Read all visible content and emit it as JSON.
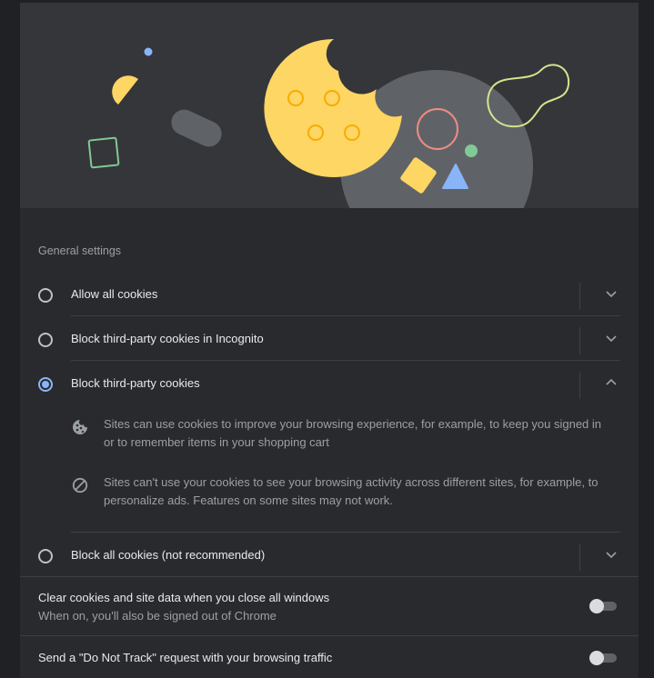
{
  "banner": {
    "illustration": "cookie-illustration"
  },
  "general": {
    "title": "General settings",
    "options": [
      {
        "label": "Allow all cookies",
        "selected": false,
        "expanded": false
      },
      {
        "label": "Block third-party cookies in Incognito",
        "selected": false,
        "expanded": false
      },
      {
        "label": "Block third-party cookies",
        "selected": true,
        "expanded": true
      },
      {
        "label": "Block all cookies (not recommended)",
        "selected": false,
        "expanded": false
      }
    ],
    "details": [
      {
        "icon": "cookie-icon",
        "text": "Sites can use cookies to improve your browsing experience, for example, to keep you signed in or to remember items in your shopping cart"
      },
      {
        "icon": "block-icon",
        "text": "Sites can't use your cookies to see your browsing activity across different sites, for example, to personalize ads. Features on some sites may not work."
      }
    ]
  },
  "clear_on_exit": {
    "title": "Clear cookies and site data when you close all windows",
    "subtitle": "When on, you'll also be signed out of Chrome",
    "enabled": false
  },
  "do_not_track": {
    "title": "Send a \"Do Not Track\" request with your browsing traffic",
    "enabled": false
  },
  "colors": {
    "page_bg": "#202124",
    "card_bg": "#292a2d",
    "banner_bg": "#35363a",
    "accent": "#8ab4f8",
    "cookie": "#fdd663"
  }
}
